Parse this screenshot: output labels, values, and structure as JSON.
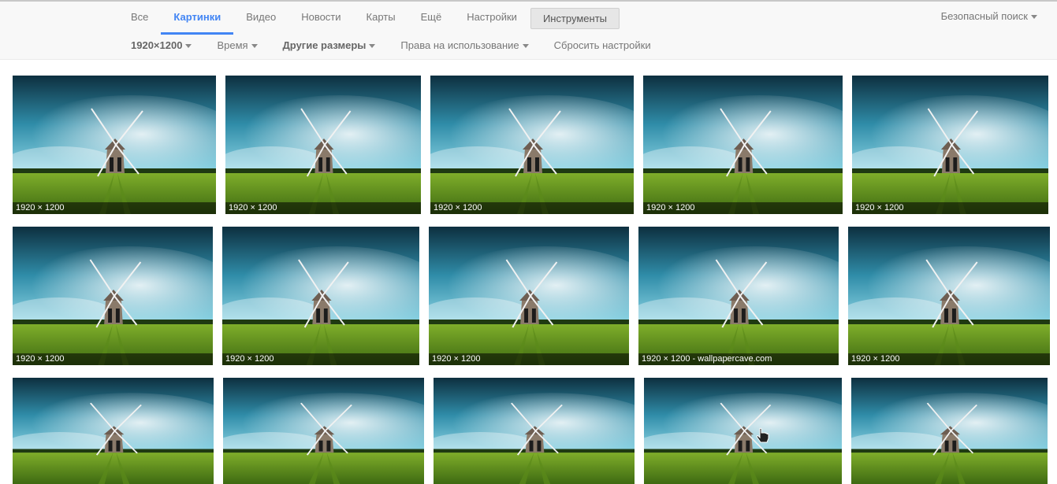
{
  "tabs": [
    {
      "label": "Все",
      "active": false
    },
    {
      "label": "Картинки",
      "active": true
    },
    {
      "label": "Видео",
      "active": false
    },
    {
      "label": "Новости",
      "active": false
    },
    {
      "label": "Карты",
      "active": false
    },
    {
      "label": "Ещё",
      "active": false
    },
    {
      "label": "Настройки",
      "active": false
    },
    {
      "label": "Инструменты",
      "active": false
    }
  ],
  "safe_search": "Безопасный поиск",
  "filters": [
    {
      "label": "1920×1200",
      "dropdown": true,
      "bold": true
    },
    {
      "label": "Время",
      "dropdown": true,
      "bold": false
    },
    {
      "label": "Другие размеры",
      "dropdown": true,
      "bold": true
    },
    {
      "label": "Права на использование",
      "dropdown": true,
      "bold": false
    },
    {
      "label": "Сбросить настройки",
      "dropdown": false,
      "bold": false
    }
  ],
  "results": [
    [
      "1920 × 1200",
      "1920 × 1200",
      "1920 × 1200",
      "1920 × 1200",
      "1920 × 1200"
    ],
    [
      "1920 × 1200",
      "1920 × 1200",
      "1920 × 1200",
      "1920 × 1200 - wallpapercave.com",
      "1920 × 1200"
    ],
    [
      "",
      "",
      "",
      "",
      ""
    ]
  ],
  "thumbnail_subject": "windmill-in-green-field-icon",
  "colors": {
    "accent": "#4285f4",
    "header_bg": "#f8f8f8"
  }
}
